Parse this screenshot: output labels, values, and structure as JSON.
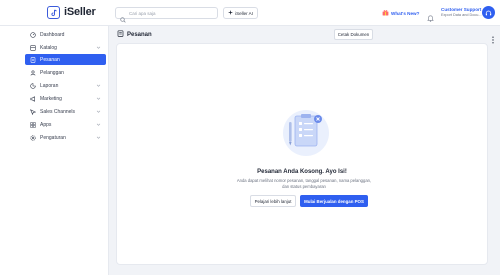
{
  "header": {
    "brand": "iSeller",
    "search_placeholder": "Cari apa saja",
    "ai_label": "iSeller AI",
    "whats_new": "What's New?",
    "support_title": "Customer Support",
    "support_subtitle": "Export Data and Docu..."
  },
  "sidebar": {
    "items": [
      {
        "label": "Dashboard",
        "icon": "home-icon",
        "has_chevron": false
      },
      {
        "label": "Katalog",
        "icon": "catalog-icon",
        "has_chevron": true
      },
      {
        "label": "Pesanan",
        "icon": "orders-icon",
        "has_chevron": false,
        "active": true
      },
      {
        "label": "Pelanggan",
        "icon": "customers-icon",
        "has_chevron": false
      },
      {
        "label": "Laporan",
        "icon": "report-icon",
        "has_chevron": true
      },
      {
        "label": "Marketing",
        "icon": "marketing-icon",
        "has_chevron": true
      },
      {
        "label": "Sales Channels",
        "icon": "channels-icon",
        "has_chevron": true
      },
      {
        "label": "Apps",
        "icon": "apps-icon",
        "has_chevron": true
      },
      {
        "label": "Pengaturan",
        "icon": "settings-icon",
        "has_chevron": true
      }
    ]
  },
  "main": {
    "title": "Pesanan",
    "export_label": "Cetak Dokumen",
    "empty": {
      "title": "Pesanan Anda Kosong. Ayo Isi!",
      "description": "Anda dapat melihat nomor pesanan, tanggal pesanan, nama pelanggan, dan status pembayaran",
      "learn_label": "Pelajari lebih lanjut",
      "primary_label": "Mulai Berjualan dengan POS"
    }
  },
  "colors": {
    "accent": "#2f5ff0",
    "background": "#f1f3f7",
    "card": "#ffffff"
  }
}
